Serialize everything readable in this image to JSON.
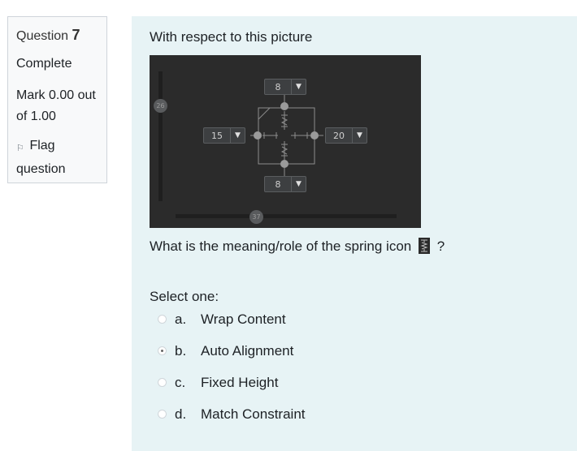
{
  "info": {
    "question_label": "Question",
    "question_number": "7",
    "state": "Complete",
    "grade": "Mark 0.00 out of 1.00",
    "flag_label": "Flag question",
    "flag_icon": "flag-icon"
  },
  "question": {
    "intro": "With respect to this picture",
    "prompt_before_icon": "What is the meaning/role of the spring icon",
    "prompt_after_icon": "?",
    "inline_icon": "spring-icon",
    "select_label": "Select one:",
    "selected_option": "b"
  },
  "editor": {
    "top_margin": "8",
    "bottom_margin": "8",
    "left_margin": "15",
    "right_margin": "20",
    "vertical_bias": "26",
    "horizontal_bias": "37",
    "background_color": "#2b2b2b"
  },
  "answers": [
    {
      "letter": "a.",
      "text": "Wrap Content",
      "checked": false
    },
    {
      "letter": "b.",
      "text": "Auto Alignment",
      "checked": true
    },
    {
      "letter": "c.",
      "text": "Fixed Height",
      "checked": false
    },
    {
      "letter": "d.",
      "text": "Match Constraint",
      "checked": false
    }
  ],
  "colors": {
    "content_background": "#e7f3f5",
    "info_background": "#f8f9fa",
    "info_border": "#cfd4da"
  }
}
